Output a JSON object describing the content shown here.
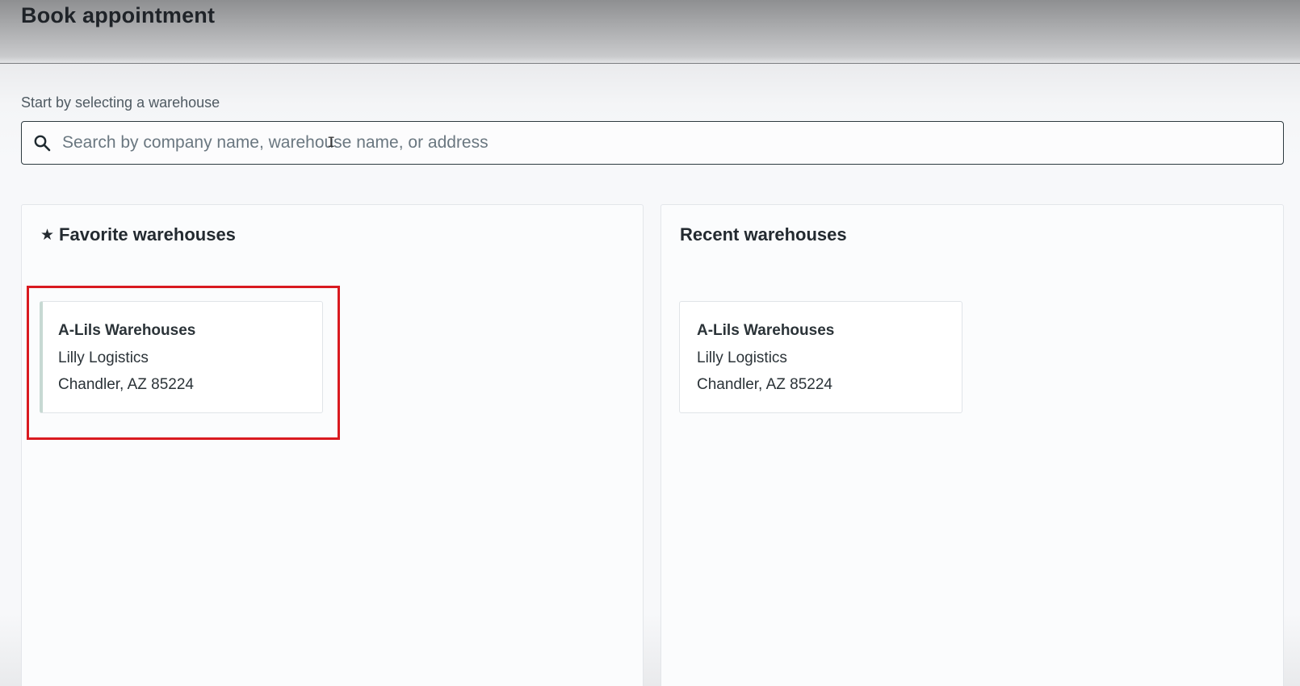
{
  "header": {
    "title": "Book appointment"
  },
  "search": {
    "label": "Start by selecting a warehouse",
    "placeholder": "Search by company name, warehouse name, or address",
    "value": ""
  },
  "favorites": {
    "title": "Favorite warehouses",
    "icon": "star-icon",
    "items": [
      {
        "name": "A-Lils Warehouses",
        "company": "Lilly Logistics",
        "address": "Chandler, AZ 85224"
      }
    ]
  },
  "recent": {
    "title": "Recent warehouses",
    "items": [
      {
        "name": "A-Lils Warehouses",
        "company": "Lilly Logistics",
        "address": "Chandler, AZ 85224"
      }
    ]
  },
  "colors": {
    "highlight": "#d91a20",
    "favorite_card_accent": "#c7d9d3"
  }
}
